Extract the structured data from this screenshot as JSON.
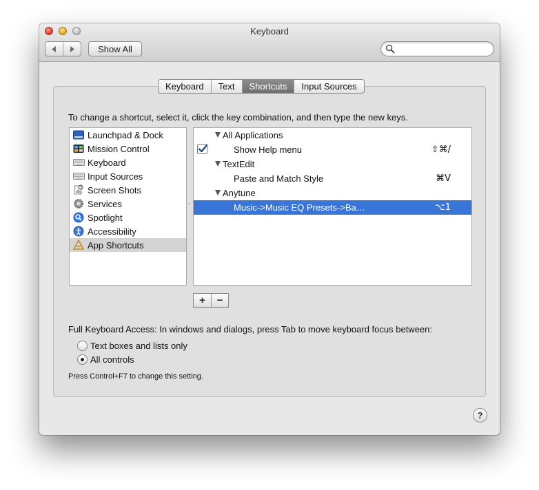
{
  "window": {
    "title": "Keyboard"
  },
  "toolbar": {
    "back_icon": "chevron-left-icon",
    "forward_icon": "chevron-right-icon",
    "show_all_label": "Show All",
    "search_placeholder": "",
    "search_value": ""
  },
  "tabs": [
    {
      "label": "Keyboard",
      "selected": false
    },
    {
      "label": "Text",
      "selected": false
    },
    {
      "label": "Shortcuts",
      "selected": true
    },
    {
      "label": "Input Sources",
      "selected": false
    }
  ],
  "instruction": "To change a shortcut, select it, click the key combination, and then type the new keys.",
  "categories": [
    {
      "label": "Launchpad & Dock",
      "icon": "launchpad-icon",
      "selected": false
    },
    {
      "label": "Mission Control",
      "icon": "mission-control-icon",
      "selected": false
    },
    {
      "label": "Keyboard",
      "icon": "keyboard-icon",
      "selected": false
    },
    {
      "label": "Input Sources",
      "icon": "input-sources-icon",
      "selected": false
    },
    {
      "label": "Screen Shots",
      "icon": "screenshot-icon",
      "selected": false
    },
    {
      "label": "Services",
      "icon": "gear-icon",
      "selected": false
    },
    {
      "label": "Spotlight",
      "icon": "spotlight-icon",
      "selected": false
    },
    {
      "label": "Accessibility",
      "icon": "accessibility-icon",
      "selected": false
    },
    {
      "label": "App Shortcuts",
      "icon": "app-store-icon",
      "selected": true
    }
  ],
  "shortcuts": [
    {
      "type": "group",
      "label": "All Applications"
    },
    {
      "type": "item",
      "label": "Show Help menu",
      "keys": "⇧⌘/",
      "checked": true,
      "selected": false
    },
    {
      "type": "group",
      "label": "TextEdit"
    },
    {
      "type": "item",
      "label": "Paste and Match Style",
      "keys": "⌘V",
      "checked": false,
      "selected": false
    },
    {
      "type": "group",
      "label": "Anytune"
    },
    {
      "type": "item",
      "label": "Music->Music EQ Presets->Ba…",
      "keys": "⌥1",
      "checked": false,
      "selected": true
    }
  ],
  "buttons": {
    "add_label": "+",
    "remove_label": "−"
  },
  "full_keyboard_access": {
    "label": "Full Keyboard Access: In windows and dialogs, press Tab to move keyboard focus between:",
    "options": [
      {
        "label": "Text boxes and lists only",
        "checked": false
      },
      {
        "label": "All controls",
        "checked": true
      }
    ],
    "hint": "Press Control+F7 to change this setting."
  },
  "help_label": "?",
  "colors": {
    "selection_blue": "#3875d7",
    "selected_tab": "#7d7d7d",
    "window_bg": "#e8e8e8",
    "close": "#e0443a",
    "minimize": "#e9a92c",
    "zoom": "#bdbdbd"
  }
}
